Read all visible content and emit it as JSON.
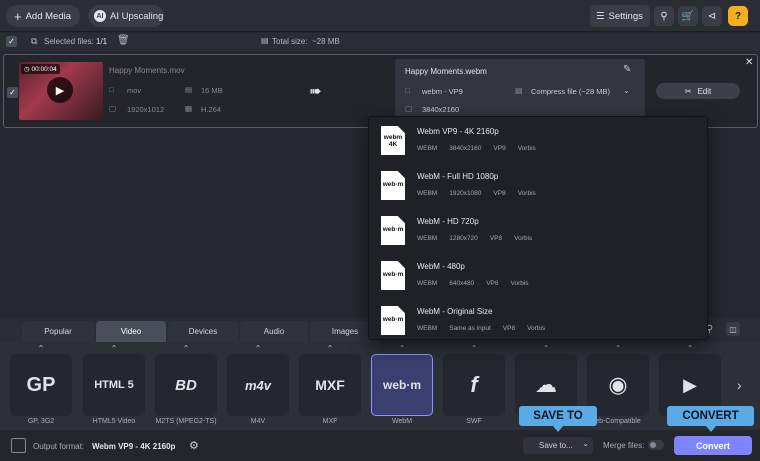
{
  "toolbar": {
    "add_media": "Add Media",
    "ai_upscaling": "AI Upscaling",
    "settings": "Settings"
  },
  "selection": {
    "selected_label": "Selected files:",
    "selected_value": "1/1",
    "total_label": "Total size:",
    "total_value": "~28 MB"
  },
  "file": {
    "timestamp": "00:00:04",
    "name": "Happy Moments.mov",
    "container": "mov",
    "size": "16 MB",
    "resolution": "1920x1012",
    "codec": "H.264"
  },
  "output": {
    "name": "Happy Moments.webm",
    "format": "webm - VP9",
    "compress": "Compress file (~28 MB)",
    "resolution": "3840x2160",
    "edit_label": "Edit"
  },
  "presets": [
    {
      "icon_top": "webm",
      "icon_bottom": "4K",
      "name": "Webm VP9 - 4K 2160p",
      "container": "WEBM",
      "resolution": "3840x2160",
      "video": "VP9",
      "audio": "Vorbis"
    },
    {
      "icon_top": "web",
      "icon_bottom": "m",
      "name": "WebM - Full HD 1080p",
      "container": "WEBM",
      "resolution": "1920x1080",
      "video": "VP8",
      "audio": "Vorbis"
    },
    {
      "icon_top": "web",
      "icon_bottom": "m",
      "name": "WebM - HD 720p",
      "container": "WEBM",
      "resolution": "1280x720",
      "video": "VP8",
      "audio": "Vorbis"
    },
    {
      "icon_top": "web",
      "icon_bottom": "m",
      "name": "WebM - 480p",
      "container": "WEBM",
      "resolution": "640x480",
      "video": "VP8",
      "audio": "Vorbis"
    },
    {
      "icon_top": "web",
      "icon_bottom": "m",
      "name": "WebM - Original Size",
      "container": "WEBM",
      "resolution": "Same as input",
      "video": "VP8",
      "audio": "Vorbis"
    }
  ],
  "tabs": [
    "Popular",
    "Video",
    "Devices",
    "Audio",
    "Images"
  ],
  "format_tiles": [
    {
      "glyph": "GP",
      "label": "GP, 3G2"
    },
    {
      "glyph": "HTML 5",
      "label": "HTML5 Video"
    },
    {
      "glyph": "BD",
      "label": "M2TS (MPEG2-TS)"
    },
    {
      "glyph": "m4v",
      "label": "M4V"
    },
    {
      "glyph": "MXF",
      "label": "MXF"
    },
    {
      "glyph": "web·m",
      "label": "WebM"
    },
    {
      "glyph": "f",
      "label": "SWF"
    },
    {
      "glyph": "☁",
      "label": ""
    },
    {
      "glyph": "◉",
      "label": "eb-Compatible"
    },
    {
      "glyph": "▶",
      "label": ""
    }
  ],
  "bottom": {
    "output_format_label": "Output format:",
    "output_format_value": "Webm VP9 - 4K 2160p",
    "save_to": "Save to...",
    "merge_files": "Merge files:",
    "convert": "Convert"
  },
  "callouts": {
    "save_to": "SAVE TO",
    "convert": "CONVERT"
  },
  "colors": {
    "accent": "#8e96ff",
    "convert_button": "#7c84ff",
    "callout": "#5aaae6"
  }
}
